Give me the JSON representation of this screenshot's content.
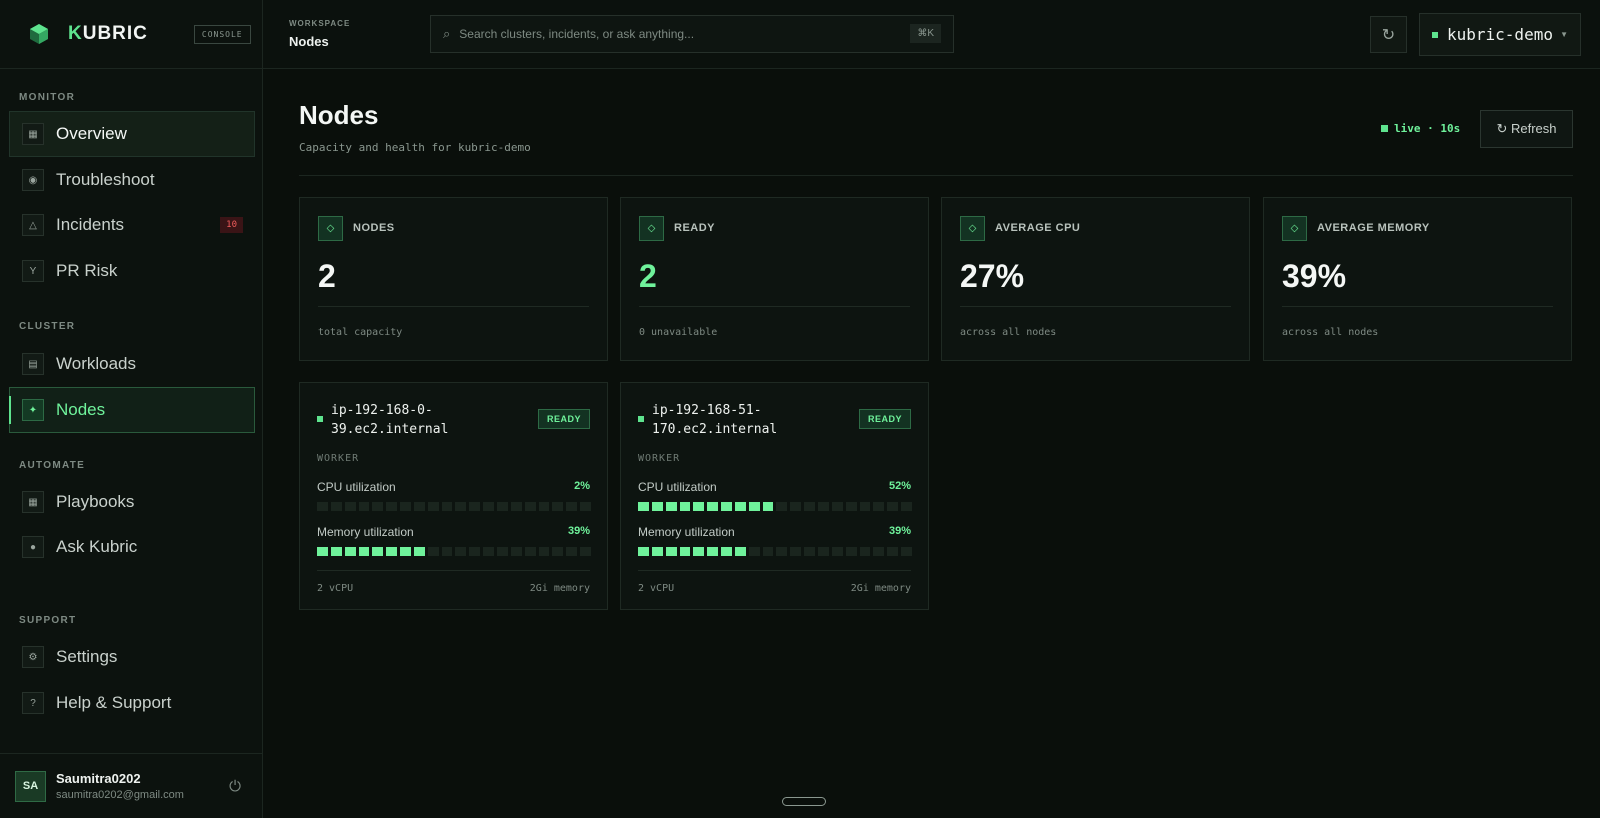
{
  "brand": {
    "name_prefix": "K",
    "name_rest": "UBRIC",
    "badge": "CONSOLE"
  },
  "sidebar": {
    "sections": {
      "monitor": "MONITOR",
      "cluster": "CLUSTER",
      "automate": "AUTOMATE",
      "support": "SUPPORT"
    },
    "items": [
      {
        "label": "Overview",
        "icon": "grid-icon"
      },
      {
        "label": "Troubleshoot",
        "icon": "target-icon"
      },
      {
        "label": "Incidents",
        "icon": "triangle-icon",
        "badge": "10"
      },
      {
        "label": "PR Risk",
        "icon": "branch-icon"
      },
      {
        "label": "Workloads",
        "icon": "list-icon"
      },
      {
        "label": "Nodes",
        "icon": "sparkle-icon"
      },
      {
        "label": "Playbooks",
        "icon": "book-icon"
      },
      {
        "label": "Ask Kubric",
        "icon": "chat-icon"
      },
      {
        "label": "Settings",
        "icon": "gear-icon"
      },
      {
        "label": "Help & Support",
        "icon": "question-icon"
      }
    ]
  },
  "user": {
    "initials": "SA",
    "name": "Saumitra0202",
    "email": "saumitra0202@gmail.com"
  },
  "topbar": {
    "workspace_label": "WORKSPACE",
    "workspace_value": "Nodes",
    "search_placeholder": "Search clusters, incidents, or ask anything...",
    "search_shortcut": "⌘K",
    "cluster_name": "kubric-demo"
  },
  "page": {
    "title": "Nodes",
    "subtitle": "Capacity and health for kubric-demo",
    "live_text": "live · 10s",
    "refresh_label": "↻ Refresh"
  },
  "stats": [
    {
      "label": "NODES",
      "value": "2",
      "sub": "total capacity"
    },
    {
      "label": "READY",
      "value": "2",
      "sub": "0 unavailable"
    },
    {
      "label": "AVERAGE CPU",
      "value": "27%",
      "sub": "across all nodes"
    },
    {
      "label": "AVERAGE MEMORY",
      "value": "39%",
      "sub": "across all nodes"
    }
  ],
  "nodes": [
    {
      "name": "ip-192-168-0-39.ec2.internal",
      "name_line1": "ip-192-168-0-",
      "name_line2": "39.ec2.internal",
      "status": "READY",
      "role": "WORKER",
      "cpu_label": "CPU utilization",
      "cpu_value": "2%",
      "cpu_fraction": 0.02,
      "mem_label": "Memory utilization",
      "mem_value": "39%",
      "mem_fraction": 0.39,
      "vcpu": "2 vCPU",
      "memory": "2Gi memory"
    },
    {
      "name": "ip-192-168-51-170.ec2.internal",
      "name_line1": "ip-192-168-51-",
      "name_line2": "170.ec2.internal",
      "status": "READY",
      "role": "WORKER",
      "cpu_label": "CPU utilization",
      "cpu_value": "52%",
      "cpu_fraction": 0.52,
      "mem_label": "Memory utilization",
      "mem_value": "39%",
      "mem_fraction": 0.39,
      "vcpu": "2 vCPU",
      "memory": "2Gi memory"
    }
  ],
  "colors": {
    "accent": "#5ee38e",
    "accent_bright": "#6ff29b",
    "danger": "#ef5b5b",
    "background": "#0a0f0b"
  }
}
